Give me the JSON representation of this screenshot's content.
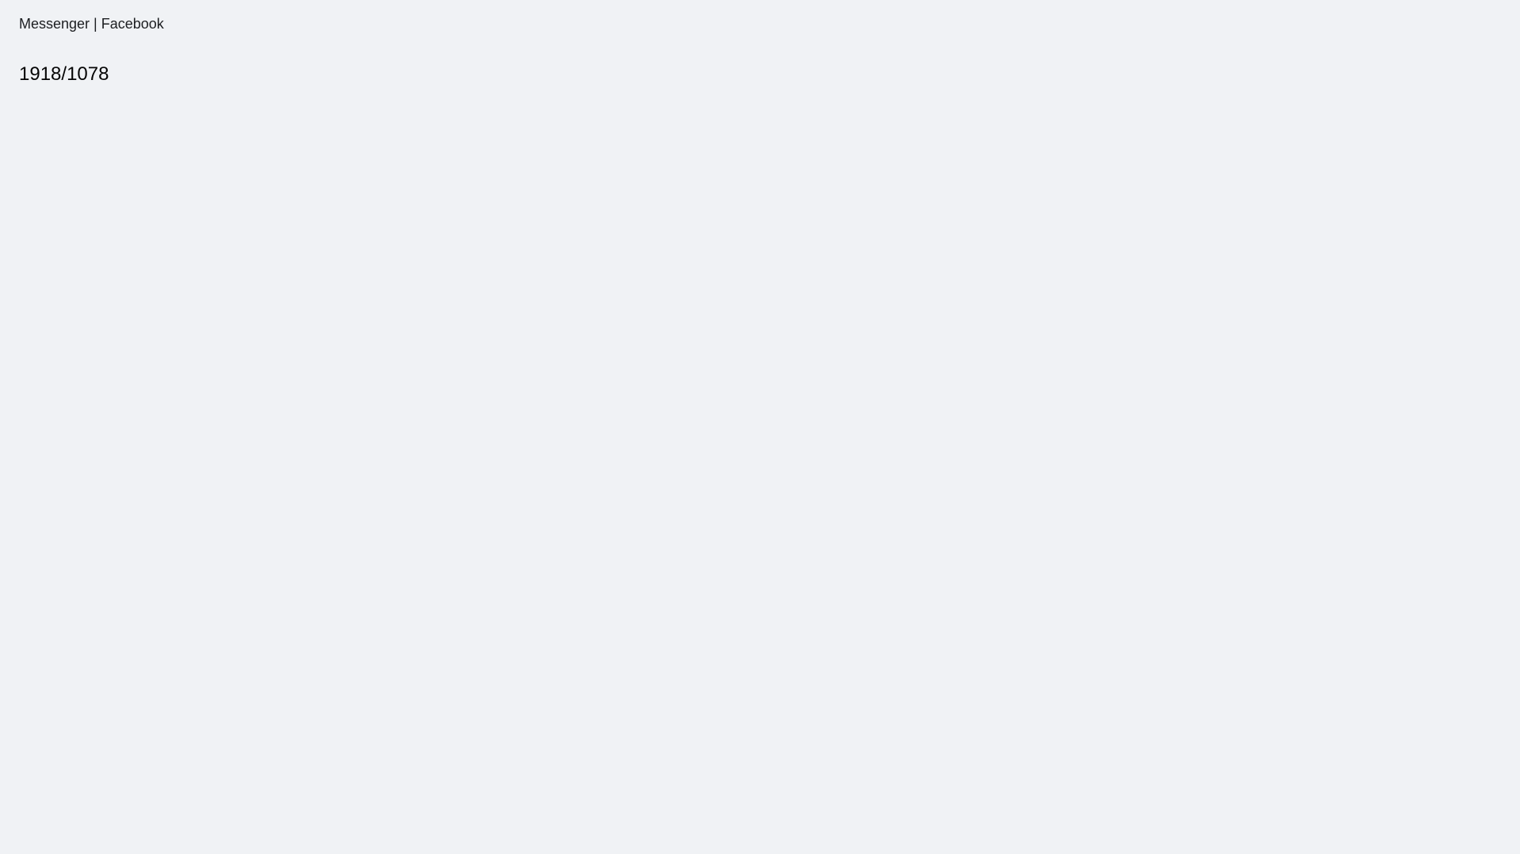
{
  "title": "Messenger | Facebook",
  "chart_data": {
    "type": "table",
    "pair": [
      "1918",
      "1078"
    ]
  }
}
